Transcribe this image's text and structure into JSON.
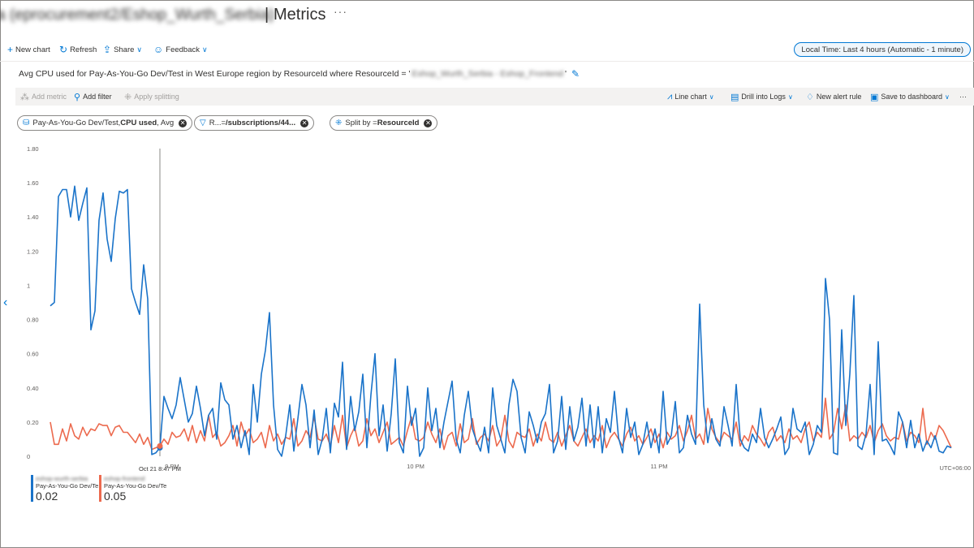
{
  "header": {
    "blurred_scope": "a (eprocurement2/Eshop_Wurth_Serbia)",
    "separator": "|",
    "title": "Metrics",
    "more": "···"
  },
  "commands": {
    "new_chart": "New chart",
    "refresh": "Refresh",
    "share": "Share",
    "feedback": "Feedback",
    "time_range": "Local Time: Last 4 hours (Automatic - 1 minute)"
  },
  "chart_header": {
    "title_prefix": "Avg CPU used for Pay-As-You-Go Dev/Test in West Europe region by ResourceId where ResourceId = '",
    "blurred_resource": "Eshop_Wurth_Serbia - Eshop_Frontend",
    "title_suffix": "'"
  },
  "chart_toolbar": {
    "add_metric": "Add metric",
    "add_filter": "Add filter",
    "apply_splitting": "Apply splitting",
    "line_chart": "Line chart",
    "drill_into_logs": "Drill into Logs",
    "new_alert_rule": "New alert rule",
    "save_to_dashboard": "Save to dashboard",
    "more": "···"
  },
  "pills": {
    "metric_scope": "Pay-As-You-Go Dev/Test, ",
    "metric_name": "CPU used",
    "metric_agg": ", Avg",
    "filter_key": "R... ",
    "filter_op": " = ",
    "filter_value": "/subscriptions/44...",
    "split_label": "Split by = ",
    "split_value": "ResourceId"
  },
  "legend": [
    {
      "blurred": "eshop-wurth-serbia",
      "name": "Pay-As-You-Go Dev/Te",
      "value": "0.02",
      "color": "#1a73c9"
    },
    {
      "blurred": "eshop-frontend",
      "name": "Pay-As-You-Go Dev/Te",
      "value": "0.05",
      "color": "#ec6a4e"
    }
  ],
  "chart_data": {
    "type": "line",
    "ylim": [
      0,
      1.8
    ],
    "y_ticks": [
      "1.80",
      "1.60",
      "1.40",
      "1.20",
      "1",
      "0.80",
      "0.60",
      "0.40",
      "0.20",
      "0"
    ],
    "x_range": [
      0,
      222
    ],
    "x_ticks": [
      {
        "x": 30,
        "label": "9 PM"
      },
      {
        "x": 90,
        "label": "10 PM"
      },
      {
        "x": 150,
        "label": "11 PM"
      }
    ],
    "timezone_label": "UTC+06:00",
    "cursor": {
      "x": 27,
      "label": "Oct 21 8:47 PM"
    },
    "series": [
      {
        "color": "#1a73c9",
        "values": [
          0.88,
          0.9,
          1.52,
          1.56,
          1.56,
          1.4,
          1.58,
          1.38,
          1.48,
          1.57,
          0.74,
          0.85,
          1.38,
          1.54,
          1.27,
          1.14,
          1.39,
          1.55,
          1.54,
          1.56,
          0.98,
          0.9,
          0.83,
          1.12,
          0.92,
          0.01,
          0.02,
          0.05,
          0.35,
          0.28,
          0.22,
          0.3,
          0.46,
          0.33,
          0.2,
          0.25,
          0.41,
          0.28,
          0.12,
          0.24,
          0.28,
          0.1,
          0.43,
          0.33,
          0.3,
          0.1,
          0.18,
          0.05,
          0.15,
          0.01,
          0.42,
          0.2,
          0.48,
          0.62,
          0.84,
          0.3,
          0.04,
          0.0,
          0.12,
          0.3,
          0.03,
          0.22,
          0.42,
          0.3,
          0.05,
          0.27,
          0.01,
          0.1,
          0.28,
          0.02,
          0.31,
          0.23,
          0.55,
          0.04,
          0.35,
          0.15,
          0.26,
          0.48,
          0.05,
          0.36,
          0.6,
          0.12,
          0.3,
          0.03,
          0.25,
          0.57,
          0.08,
          0.02,
          0.41,
          0.18,
          0.28,
          0.0,
          0.05,
          0.4,
          0.15,
          0.28,
          0.05,
          0.2,
          0.32,
          0.44,
          0.1,
          0.02,
          0.24,
          0.38,
          0.16,
          0.09,
          0.03,
          0.17,
          0.02,
          0.4,
          0.18,
          0.1,
          0.02,
          0.3,
          0.45,
          0.38,
          0.11,
          0.02,
          0.26,
          0.18,
          0.08,
          0.2,
          0.25,
          0.42,
          0.02,
          0.09,
          0.35,
          0.04,
          0.29,
          0.09,
          0.17,
          0.34,
          0.06,
          0.3,
          0.05,
          0.29,
          0.02,
          0.22,
          0.14,
          0.38,
          0.11,
          0.02,
          0.28,
          0.11,
          0.2,
          0.01,
          0.07,
          0.2,
          0.05,
          0.16,
          0.02,
          0.38,
          0.07,
          0.12,
          0.32,
          0.02,
          0.05,
          0.24,
          0.13,
          0.07,
          0.89,
          0.3,
          0.08,
          0.22,
          0.1,
          0.06,
          0.29,
          0.18,
          0.06,
          0.42,
          0.1,
          0.05,
          0.03,
          0.13,
          0.08,
          0.28,
          0.11,
          0.05,
          0.1,
          0.16,
          0.23,
          0.01,
          0.05,
          0.28,
          0.16,
          0.14,
          0.2,
          0.01,
          0.07,
          0.18,
          0.14,
          1.04,
          0.8,
          0.02,
          0.01,
          0.74,
          0.18,
          0.48,
          0.94,
          0.06,
          0.04,
          0.13,
          0.42,
          0.01,
          0.67,
          0.09,
          0.1,
          0.06,
          0.01,
          0.26,
          0.2,
          0.05,
          0.21,
          0.05,
          0.13,
          0.03,
          0.09,
          0.05,
          0.12,
          0.03,
          0.02,
          0.06,
          0.05
        ],
        "name": ""
      },
      {
        "color": "#ec6a4e",
        "values": [
          0.2,
          0.07,
          0.07,
          0.16,
          0.09,
          0.19,
          0.12,
          0.1,
          0.17,
          0.12,
          0.16,
          0.15,
          0.19,
          0.18,
          0.18,
          0.12,
          0.17,
          0.18,
          0.14,
          0.14,
          0.11,
          0.08,
          0.13,
          0.07,
          0.11,
          0.04,
          0.05,
          0.06,
          0.1,
          0.07,
          0.14,
          0.11,
          0.12,
          0.16,
          0.09,
          0.18,
          0.08,
          0.15,
          0.09,
          0.24,
          0.11,
          0.14,
          0.06,
          0.08,
          0.12,
          0.18,
          0.06,
          0.2,
          0.12,
          0.16,
          0.08,
          0.1,
          0.14,
          0.05,
          0.18,
          0.09,
          0.13,
          0.07,
          0.11,
          0.1,
          0.22,
          0.06,
          0.09,
          0.15,
          0.11,
          0.23,
          0.1,
          0.09,
          0.13,
          0.06,
          0.18,
          0.08,
          0.24,
          0.05,
          0.12,
          0.17,
          0.06,
          0.09,
          0.22,
          0.12,
          0.16,
          0.08,
          0.14,
          0.2,
          0.07,
          0.09,
          0.11,
          0.06,
          0.15,
          0.23,
          0.1,
          0.09,
          0.11,
          0.2,
          0.13,
          0.08,
          0.16,
          0.04,
          0.12,
          0.14,
          0.06,
          0.19,
          0.08,
          0.1,
          0.22,
          0.07,
          0.11,
          0.13,
          0.09,
          0.18,
          0.06,
          0.1,
          0.24,
          0.09,
          0.05,
          0.14,
          0.12,
          0.11,
          0.16,
          0.06,
          0.13,
          0.09,
          0.2,
          0.1,
          0.08,
          0.14,
          0.06,
          0.12,
          0.18,
          0.09,
          0.06,
          0.11,
          0.16,
          0.08,
          0.12,
          0.09,
          0.18,
          0.05,
          0.11,
          0.14,
          0.1,
          0.06,
          0.13,
          0.17,
          0.09,
          0.12,
          0.07,
          0.11,
          0.16,
          0.08,
          0.13,
          0.05,
          0.14,
          0.1,
          0.12,
          0.18,
          0.09,
          0.15,
          0.24,
          0.1,
          0.13,
          0.07,
          0.28,
          0.16,
          0.11,
          0.08,
          0.14,
          0.12,
          0.1,
          0.2,
          0.06,
          0.12,
          0.09,
          0.18,
          0.13,
          0.1,
          0.06,
          0.14,
          0.17,
          0.09,
          0.12,
          0.08,
          0.16,
          0.1,
          0.12,
          0.08,
          0.16,
          0.2,
          0.09,
          0.14,
          0.11,
          0.34,
          0.1,
          0.14,
          0.28,
          0.16,
          0.3,
          0.09,
          0.12,
          0.1,
          0.14,
          0.11,
          0.18,
          0.08,
          0.15,
          0.19,
          0.12,
          0.09,
          0.11,
          0.1,
          0.2,
          0.09,
          0.14,
          0.12,
          0.08,
          0.28,
          0.07,
          0.14,
          0.1,
          0.18,
          0.15,
          0.1,
          0.05
        ],
        "name": ""
      }
    ]
  }
}
